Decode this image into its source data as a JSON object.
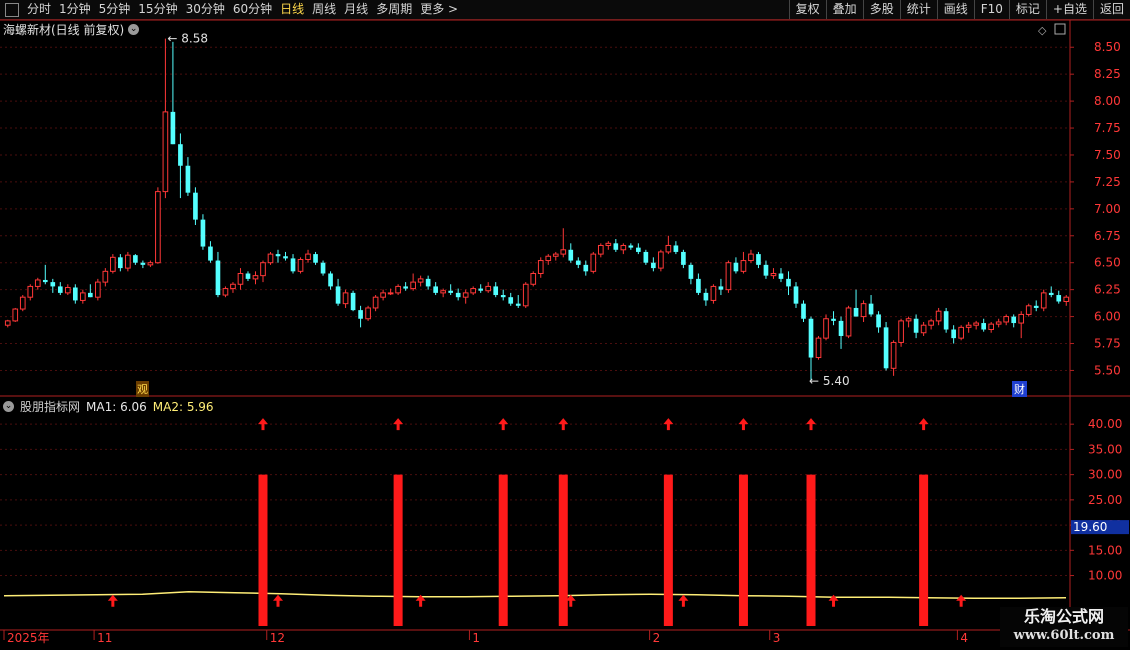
{
  "toolbar": {
    "periods": [
      "分时",
      "1分钟",
      "5分钟",
      "15分钟",
      "30分钟",
      "60分钟",
      "日线",
      "周线",
      "月线",
      "多周期",
      "更多 >"
    ],
    "active_period": "日线",
    "right_buttons": [
      "复权",
      "叠加",
      "多股",
      "统计",
      "画线",
      "F10",
      "标记",
      "+自选",
      "返回"
    ]
  },
  "main_panel": {
    "title": "海螺新材(日线 前复权)",
    "high_label": "8.58",
    "low_label": "5.40",
    "marker_left": "观",
    "marker_right": "财"
  },
  "indicator_panel": {
    "title": "股朋指标网",
    "ma1_label": "MA1: 6.06",
    "ma2_label": "MA2: 5.96",
    "current_value": "19.60"
  },
  "colors": {
    "up": "#ff3838",
    "down": "#54ffff",
    "grid": "#4a0e0e",
    "axis": "#b02020",
    "signal": "#ff1a1a",
    "ma_line": "#ffee77"
  },
  "chart_data": [
    {
      "type": "candlestick",
      "y_ticks": [
        "8.50",
        "8.25",
        "8.00",
        "7.75",
        "7.50",
        "7.25",
        "7.00",
        "6.75",
        "6.50",
        "6.25",
        "6.00",
        "5.75",
        "5.50"
      ],
      "ylim": [
        5.3,
        8.66
      ],
      "ohlc": [
        [
          5.92,
          5.97,
          5.9,
          5.96
        ],
        [
          5.96,
          6.08,
          5.95,
          6.07
        ],
        [
          6.07,
          6.2,
          6.05,
          6.18
        ],
        [
          6.18,
          6.3,
          6.15,
          6.28
        ],
        [
          6.28,
          6.36,
          6.25,
          6.34
        ],
        [
          6.34,
          6.48,
          6.3,
          6.32
        ],
        [
          6.32,
          6.35,
          6.22,
          6.28
        ],
        [
          6.28,
          6.32,
          6.2,
          6.22
        ],
        [
          6.22,
          6.3,
          6.2,
          6.27
        ],
        [
          6.27,
          6.3,
          6.12,
          6.15
        ],
        [
          6.15,
          6.25,
          6.12,
          6.22
        ],
        [
          6.22,
          6.3,
          6.18,
          6.18
        ],
        [
          6.18,
          6.35,
          6.15,
          6.32
        ],
        [
          6.32,
          6.45,
          6.28,
          6.42
        ],
        [
          6.42,
          6.58,
          6.4,
          6.55
        ],
        [
          6.55,
          6.58,
          6.42,
          6.45
        ],
        [
          6.45,
          6.6,
          6.42,
          6.57
        ],
        [
          6.57,
          6.58,
          6.48,
          6.5
        ],
        [
          6.5,
          6.52,
          6.45,
          6.48
        ],
        [
          6.48,
          6.52,
          6.46,
          6.5
        ],
        [
          6.5,
          7.2,
          6.49,
          7.16
        ],
        [
          7.16,
          8.58,
          7.1,
          7.9
        ],
        [
          7.9,
          8.55,
          7.6,
          7.6
        ],
        [
          7.6,
          7.7,
          7.1,
          7.4
        ],
        [
          7.4,
          7.48,
          7.12,
          7.15
        ],
        [
          7.15,
          7.2,
          6.85,
          6.9
        ],
        [
          6.9,
          6.95,
          6.62,
          6.65
        ],
        [
          6.65,
          6.7,
          6.5,
          6.52
        ],
        [
          6.52,
          6.6,
          6.18,
          6.2
        ],
        [
          6.2,
          6.28,
          6.18,
          6.26
        ],
        [
          6.26,
          6.32,
          6.22,
          6.3
        ],
        [
          6.3,
          6.45,
          6.25,
          6.4
        ],
        [
          6.4,
          6.42,
          6.33,
          6.35
        ],
        [
          6.35,
          6.42,
          6.3,
          6.38
        ],
        [
          6.38,
          6.52,
          6.32,
          6.5
        ],
        [
          6.5,
          6.6,
          6.48,
          6.58
        ],
        [
          6.58,
          6.62,
          6.5,
          6.56
        ],
        [
          6.56,
          6.6,
          6.52,
          6.54
        ],
        [
          6.54,
          6.58,
          6.4,
          6.42
        ],
        [
          6.42,
          6.55,
          6.4,
          6.53
        ],
        [
          6.53,
          6.62,
          6.5,
          6.58
        ],
        [
          6.58,
          6.6,
          6.48,
          6.5
        ],
        [
          6.5,
          6.52,
          6.38,
          6.4
        ],
        [
          6.4,
          6.42,
          6.25,
          6.28
        ],
        [
          6.28,
          6.35,
          6.1,
          6.12
        ],
        [
          6.12,
          6.25,
          6.08,
          6.22
        ],
        [
          6.22,
          6.24,
          6.05,
          6.06
        ],
        [
          6.06,
          6.1,
          5.9,
          5.98
        ],
        [
          5.98,
          6.1,
          5.96,
          6.08
        ],
        [
          6.08,
          6.2,
          6.05,
          6.18
        ],
        [
          6.18,
          6.25,
          6.15,
          6.22
        ],
        [
          6.22,
          6.26,
          6.2,
          6.22
        ],
        [
          6.22,
          6.3,
          6.2,
          6.28
        ],
        [
          6.28,
          6.32,
          6.24,
          6.26
        ],
        [
          6.26,
          6.4,
          6.24,
          6.32
        ],
        [
          6.32,
          6.38,
          6.28,
          6.35
        ],
        [
          6.35,
          6.38,
          6.25,
          6.28
        ],
        [
          6.28,
          6.32,
          6.2,
          6.22
        ],
        [
          6.22,
          6.26,
          6.18,
          6.24
        ],
        [
          6.24,
          6.3,
          6.2,
          6.22
        ],
        [
          6.22,
          6.26,
          6.15,
          6.18
        ],
        [
          6.18,
          6.25,
          6.12,
          6.22
        ],
        [
          6.22,
          6.28,
          6.2,
          6.26
        ],
        [
          6.26,
          6.3,
          6.22,
          6.24
        ],
        [
          6.24,
          6.32,
          6.22,
          6.28
        ],
        [
          6.28,
          6.32,
          6.18,
          6.2
        ],
        [
          6.2,
          6.25,
          6.15,
          6.18
        ],
        [
          6.18,
          6.22,
          6.1,
          6.12
        ],
        [
          6.12,
          6.2,
          6.08,
          6.1
        ],
        [
          6.1,
          6.32,
          6.08,
          6.3
        ],
        [
          6.3,
          6.42,
          6.28,
          6.4
        ],
        [
          6.4,
          6.55,
          6.36,
          6.52
        ],
        [
          6.52,
          6.58,
          6.48,
          6.56
        ],
        [
          6.56,
          6.6,
          6.52,
          6.58
        ],
        [
          6.58,
          6.82,
          6.55,
          6.62
        ],
        [
          6.62,
          6.68,
          6.5,
          6.52
        ],
        [
          6.52,
          6.55,
          6.45,
          6.48
        ],
        [
          6.48,
          6.52,
          6.38,
          6.42
        ],
        [
          6.42,
          6.6,
          6.4,
          6.58
        ],
        [
          6.58,
          6.68,
          6.55,
          6.66
        ],
        [
          6.66,
          6.7,
          6.62,
          6.68
        ],
        [
          6.68,
          6.72,
          6.6,
          6.62
        ],
        [
          6.62,
          6.68,
          6.58,
          6.66
        ],
        [
          6.66,
          6.68,
          6.62,
          6.64
        ],
        [
          6.64,
          6.68,
          6.58,
          6.6
        ],
        [
          6.6,
          6.62,
          6.48,
          6.5
        ],
        [
          6.5,
          6.55,
          6.42,
          6.45
        ],
        [
          6.45,
          6.62,
          6.42,
          6.6
        ],
        [
          6.6,
          6.75,
          6.58,
          6.66
        ],
        [
          6.66,
          6.7,
          6.58,
          6.6
        ],
        [
          6.6,
          6.62,
          6.45,
          6.48
        ],
        [
          6.48,
          6.5,
          6.3,
          6.35
        ],
        [
          6.35,
          6.4,
          6.2,
          6.22
        ],
        [
          6.22,
          6.26,
          6.1,
          6.15
        ],
        [
          6.15,
          6.3,
          6.12,
          6.28
        ],
        [
          6.28,
          6.35,
          6.2,
          6.25
        ],
        [
          6.25,
          6.52,
          6.22,
          6.5
        ],
        [
          6.5,
          6.55,
          6.4,
          6.42
        ],
        [
          6.42,
          6.6,
          6.4,
          6.52
        ],
        [
          6.52,
          6.62,
          6.5,
          6.58
        ],
        [
          6.58,
          6.6,
          6.45,
          6.48
        ],
        [
          6.48,
          6.52,
          6.35,
          6.38
        ],
        [
          6.38,
          6.45,
          6.35,
          6.4
        ],
        [
          6.4,
          6.45,
          6.32,
          6.35
        ],
        [
          6.35,
          6.42,
          6.2,
          6.28
        ],
        [
          6.28,
          6.32,
          6.08,
          6.12
        ],
        [
          6.12,
          6.15,
          5.95,
          5.98
        ],
        [
          5.98,
          6.0,
          5.4,
          5.62
        ],
        [
          5.62,
          5.82,
          5.6,
          5.8
        ],
        [
          5.8,
          6.02,
          5.78,
          5.98
        ],
        [
          5.98,
          6.05,
          5.92,
          5.96
        ],
        [
          5.96,
          6.0,
          5.7,
          5.82
        ],
        [
          5.82,
          6.1,
          5.8,
          6.08
        ],
        [
          6.08,
          6.25,
          6.02,
          6.0
        ],
        [
          6.0,
          6.15,
          5.95,
          6.12
        ],
        [
          6.12,
          6.2,
          6.0,
          6.02
        ],
        [
          6.02,
          6.05,
          5.85,
          5.9
        ],
        [
          5.9,
          5.95,
          5.5,
          5.52
        ],
        [
          5.52,
          5.78,
          5.45,
          5.76
        ],
        [
          5.76,
          5.98,
          5.72,
          5.96
        ],
        [
          5.96,
          6.0,
          5.9,
          5.98
        ],
        [
          5.98,
          6.02,
          5.8,
          5.85
        ],
        [
          5.85,
          5.95,
          5.82,
          5.92
        ],
        [
          5.92,
          5.98,
          5.88,
          5.96
        ],
        [
          5.96,
          6.08,
          5.92,
          6.05
        ],
        [
          6.05,
          6.08,
          5.85,
          5.88
        ],
        [
          5.88,
          5.92,
          5.75,
          5.8
        ],
        [
          5.8,
          5.92,
          5.78,
          5.9
        ],
        [
          5.9,
          5.95,
          5.85,
          5.92
        ],
        [
          5.92,
          5.96,
          5.88,
          5.94
        ],
        [
          5.94,
          5.98,
          5.86,
          5.88
        ],
        [
          5.88,
          5.95,
          5.85,
          5.93
        ],
        [
          5.93,
          5.98,
          5.9,
          5.95
        ],
        [
          5.95,
          6.02,
          5.92,
          6.0
        ],
        [
          6.0,
          6.02,
          5.9,
          5.94
        ],
        [
          5.94,
          6.05,
          5.8,
          6.02
        ],
        [
          6.02,
          6.12,
          6.0,
          6.1
        ],
        [
          6.1,
          6.15,
          6.05,
          6.08
        ],
        [
          6.08,
          6.25,
          6.05,
          6.22
        ],
        [
          6.22,
          6.28,
          6.18,
          6.2
        ],
        [
          6.2,
          6.24,
          6.12,
          6.14
        ],
        [
          6.14,
          6.2,
          6.1,
          6.18
        ]
      ]
    },
    {
      "type": "bar",
      "y_ticks": [
        "40.00",
        "35.00",
        "30.00",
        "25.00",
        "20.00",
        "15.00",
        "10.00"
      ],
      "ylim": [
        0,
        44
      ],
      "bar_values": [
        30,
        30,
        30,
        30,
        30,
        30,
        30,
        30
      ],
      "bar_positions": [
        34,
        52,
        66,
        74,
        88,
        98,
        107,
        122
      ],
      "top_arrow_value": 40,
      "bottom_arrow_positions": [
        14,
        36,
        55,
        75,
        90,
        110,
        127
      ],
      "ma_line_values": [
        6.0,
        6.1,
        6.2,
        6.3,
        6.8,
        6.6,
        6.4,
        6.1,
        5.9,
        5.8,
        5.8,
        5.9,
        6.0,
        6.2,
        6.3,
        6.2,
        6.0,
        5.9,
        5.7,
        5.7,
        5.6,
        5.5,
        5.5,
        5.6
      ],
      "x_labels": [
        "2025年",
        "11",
        "12",
        "1",
        "2",
        "3",
        "4"
      ],
      "x_label_positions": [
        0,
        12,
        35,
        62,
        86,
        102,
        127
      ]
    }
  ]
}
